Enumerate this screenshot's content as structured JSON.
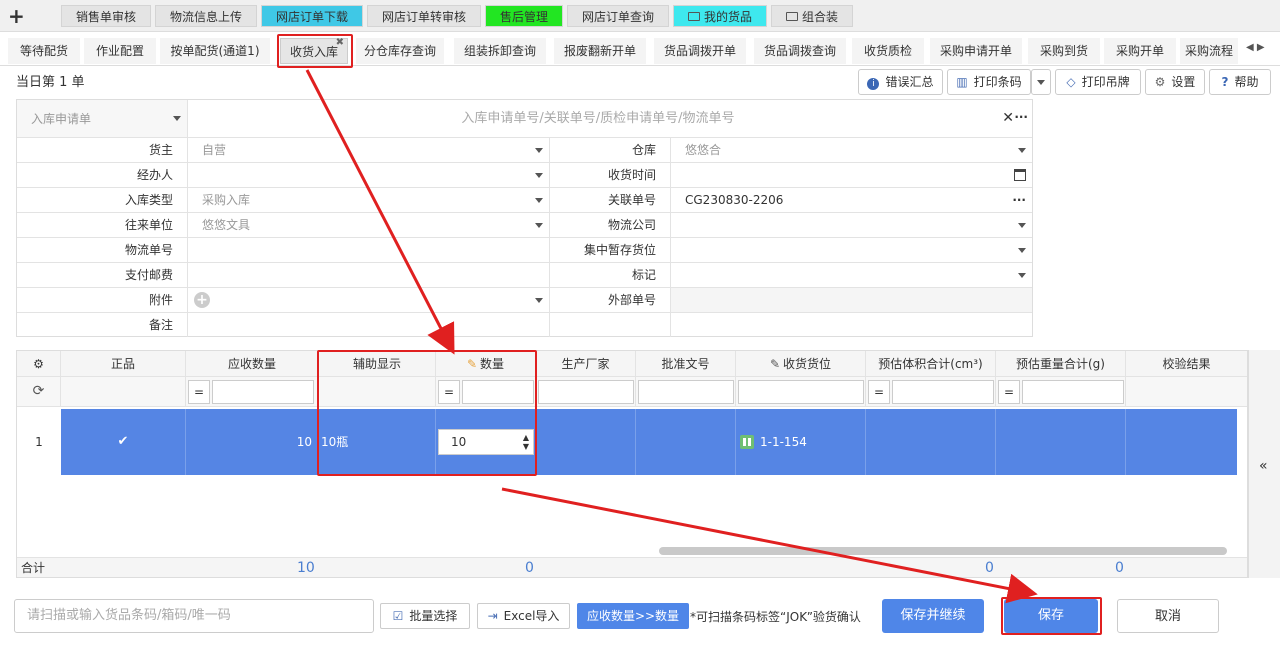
{
  "top_tabs": [
    {
      "label": "销售单审核",
      "bg": "#e4e4e4"
    },
    {
      "label": "物流信息上传",
      "bg": "#e4e4e4"
    },
    {
      "label": "网店订单下载",
      "bg": "#3fc8e6"
    },
    {
      "label": "网店订单转审核",
      "bg": "#e4e4e4"
    },
    {
      "label": "售后管理",
      "bg": "#22e622"
    },
    {
      "label": "网店订单查询",
      "bg": "#e4e4e4"
    },
    {
      "label": "我的货品",
      "bg": "#3ee8ee"
    },
    {
      "label": "组合装",
      "bg": "#e4e4e4"
    }
  ],
  "sub_tabs": [
    "等待配货",
    "作业配置",
    "按单配货(通道1)",
    "收货入库",
    "分仓库存查询",
    "组装拆卸查询",
    "报废翻新开单",
    "货品调拨开单",
    "货品调拨查询",
    "收货质检",
    "采购申请开单",
    "采购到货",
    "采购开单",
    "采购流程"
  ],
  "active_sub_tab": "收货入库",
  "today_label": "当日第 1 单",
  "toolbar": {
    "error_summary": "错误汇总",
    "print_barcode": "打印条码",
    "print_tag": "打印吊牌",
    "settings": "设置",
    "help": "帮助"
  },
  "form": {
    "request_select": "入库申请单",
    "search_placeholder": "入库申请单号/关联单号/质检申请单号/物流单号",
    "fields_left": [
      {
        "label": "货主",
        "value": "自营"
      },
      {
        "label": "经办人",
        "value": ""
      },
      {
        "label": "入库类型",
        "value": "采购入库"
      },
      {
        "label": "往来单位",
        "value": "悠悠文具"
      },
      {
        "label": "物流单号",
        "value": ""
      },
      {
        "label": "支付邮费",
        "value": ""
      },
      {
        "label": "附件",
        "value": ""
      },
      {
        "label": "备注",
        "value": ""
      }
    ],
    "fields_right": [
      {
        "label": "仓库",
        "value": "悠悠合"
      },
      {
        "label": "收货时间",
        "value": ""
      },
      {
        "label": "关联单号",
        "value": "CG230830-2206"
      },
      {
        "label": "物流公司",
        "value": ""
      },
      {
        "label": "集中暂存货位",
        "value": ""
      },
      {
        "label": "标记",
        "value": ""
      },
      {
        "label": "外部单号",
        "value": ""
      }
    ]
  },
  "grid": {
    "headers": [
      "正品",
      "应收数量",
      "辅助显示",
      "数量",
      "生产厂家",
      "批准文号",
      "收货货位",
      "预估体积合计(cm³)",
      "预估重量合计(g)",
      "校验结果"
    ],
    "filter_eq": "=",
    "row": {
      "index": "1",
      "check": "✔",
      "expected_qty": "10",
      "aux_display": "10瓶",
      "qty": "10",
      "location": "1-1-154"
    },
    "total_label": "合计",
    "totals": {
      "expected": "10",
      "qty": "0",
      "volume": "0",
      "weight": "0"
    }
  },
  "bottom": {
    "scan_placeholder": "请扫描或输入货品条码/箱码/唯一码",
    "batch_select": "批量选择",
    "excel_import": "Excel导入",
    "copy_qty": "应收数量>>数量",
    "hint": "*可扫描条码标签“JOK”验货确认",
    "save_continue": "保存并继续",
    "save": "保存",
    "cancel": "取消"
  },
  "accent": "#4f86e8",
  "row_highlight": "#5585e4",
  "annotation_red": "#e02020"
}
